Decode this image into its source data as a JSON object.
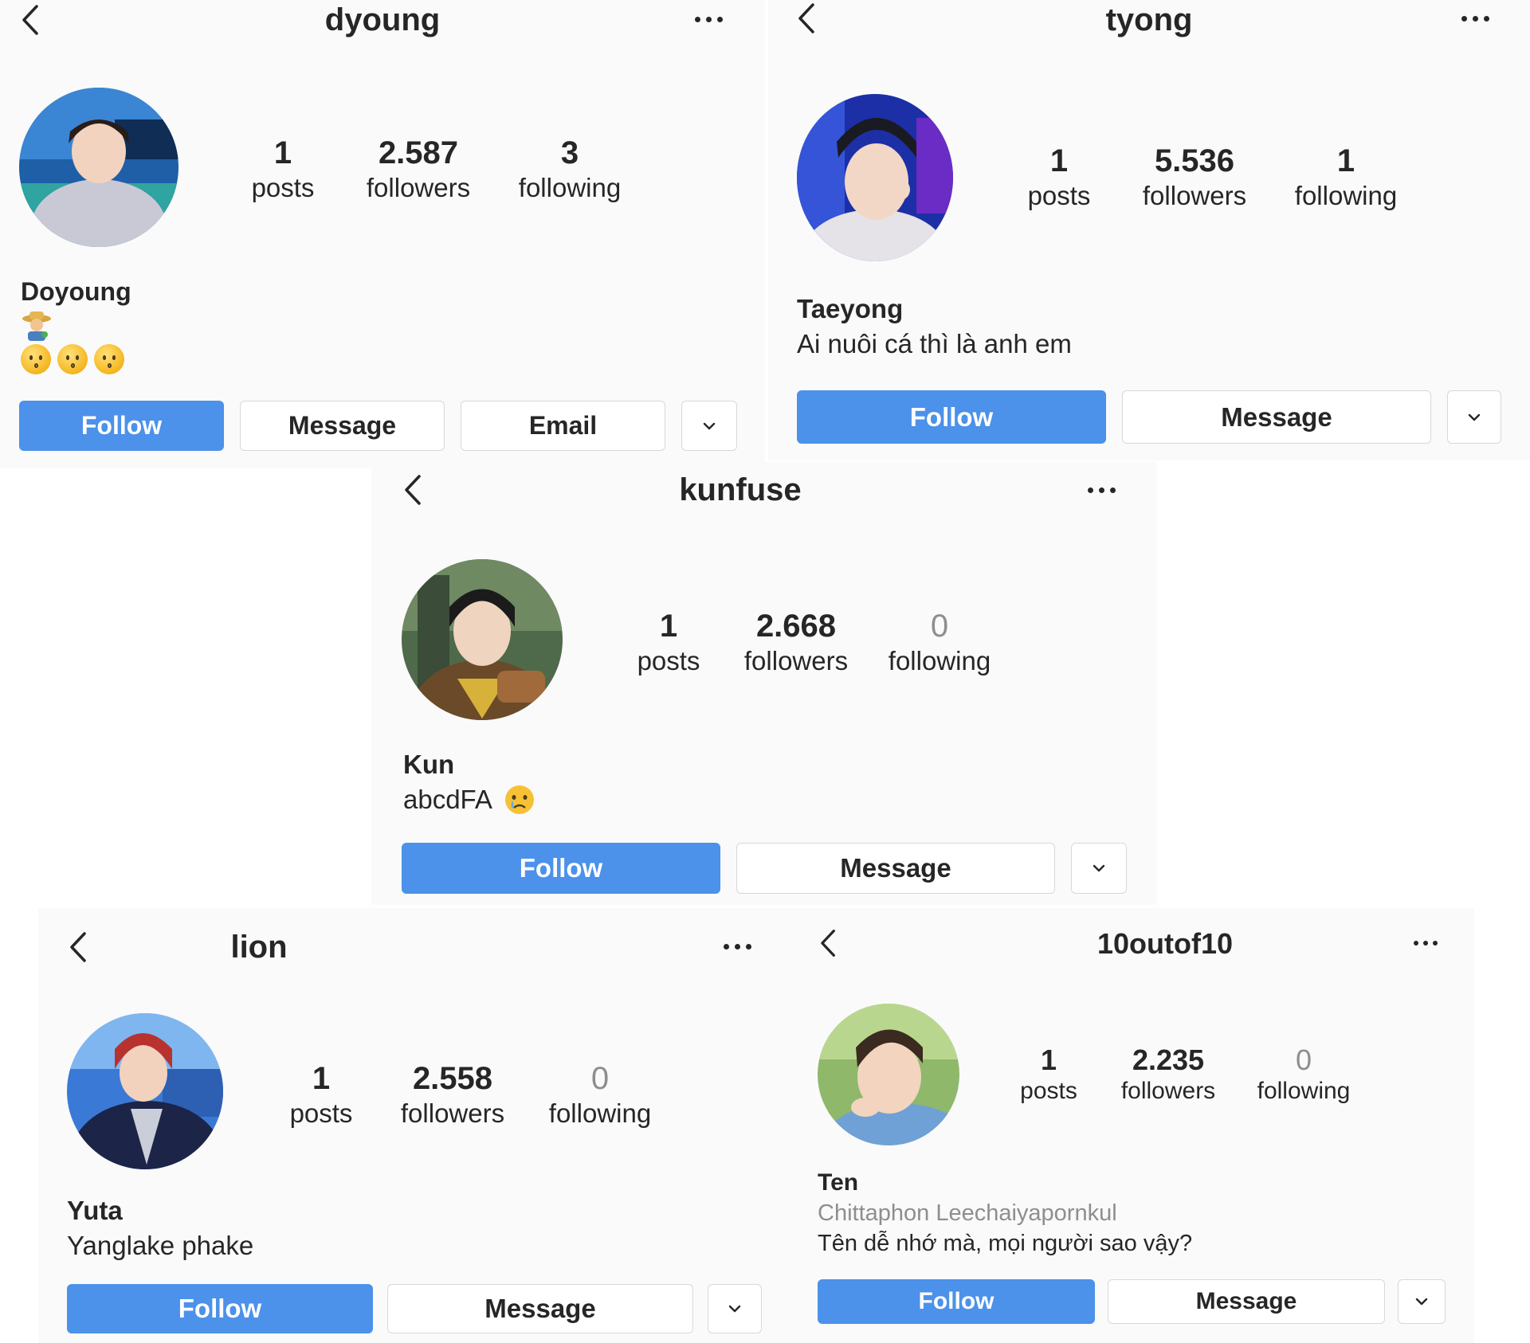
{
  "panels": [
    {
      "username": "dyoung",
      "stats": [
        {
          "value": "1",
          "label": "posts"
        },
        {
          "value": "2.587",
          "label": "followers"
        },
        {
          "value": "3",
          "label": "following"
        }
      ],
      "display_name": "Doyoung",
      "bio_lines": [],
      "bio_emojis": [
        "farmer-emoji",
        "kissing-face-emoji",
        "kissing-face-emoji",
        "kissing-face-emoji"
      ],
      "buttons": {
        "follow": "Follow",
        "message": "Message",
        "email": "Email"
      }
    },
    {
      "username": "tyong",
      "stats": [
        {
          "value": "1",
          "label": "posts"
        },
        {
          "value": "5.536",
          "label": "followers"
        },
        {
          "value": "1",
          "label": "following"
        }
      ],
      "display_name": "Taeyong",
      "bio_lines": [
        "Ai nuôi cá thì là anh em"
      ],
      "buttons": {
        "follow": "Follow",
        "message": "Message"
      }
    },
    {
      "username": "kunfuse",
      "stats": [
        {
          "value": "1",
          "label": "posts"
        },
        {
          "value": "2.668",
          "label": "followers"
        },
        {
          "value": "0",
          "label": "following"
        }
      ],
      "display_name": "Kun",
      "bio_lines": [
        "abcdFA"
      ],
      "bio_emojis": [
        "crying-face-emoji"
      ],
      "buttons": {
        "follow": "Follow",
        "message": "Message"
      }
    },
    {
      "username": "lion",
      "stats": [
        {
          "value": "1",
          "label": "posts"
        },
        {
          "value": "2.558",
          "label": "followers"
        },
        {
          "value": "0",
          "label": "following"
        }
      ],
      "display_name": "Yuta",
      "bio_lines": [
        "Yanglake phake"
      ],
      "buttons": {
        "follow": "Follow",
        "message": "Message"
      }
    },
    {
      "username": "10outof10",
      "stats": [
        {
          "value": "1",
          "label": "posts"
        },
        {
          "value": "2.235",
          "label": "followers"
        },
        {
          "value": "0",
          "label": "following"
        }
      ],
      "display_name": "Ten",
      "category": "Chittaphon Leechaiyapornkul",
      "bio_lines": [
        "Tên dễ nhớ mà, mọi người sao vậy?"
      ],
      "buttons": {
        "follow": "Follow",
        "message": "Message"
      }
    }
  ],
  "colors": {
    "follow_button": "#4c91ea",
    "panel_background": "#fafafa",
    "text": "#262626",
    "muted_text": "#8e8e8e",
    "button_border": "#d8d8d8"
  },
  "icons": [
    "chevron-left-icon",
    "more-options-icon",
    "chevron-down-icon"
  ]
}
